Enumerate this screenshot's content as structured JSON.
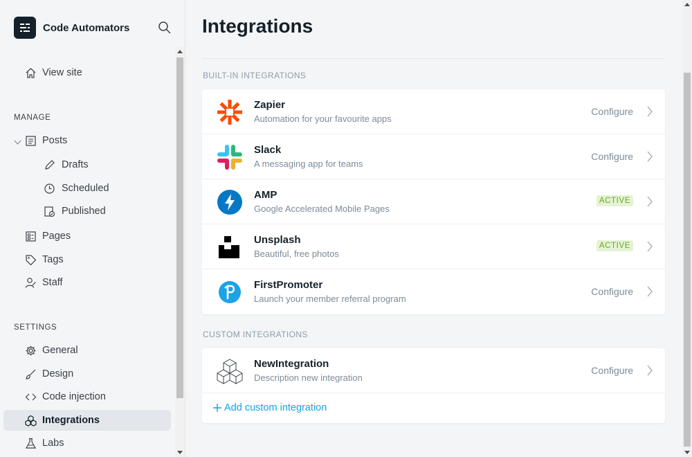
{
  "sidebar": {
    "brand": "Code Automators",
    "view_site": "View site",
    "manage_heading": "MANAGE",
    "posts": "Posts",
    "drafts": "Drafts",
    "scheduled": "Scheduled",
    "published": "Published",
    "pages": "Pages",
    "tags": "Tags",
    "staff": "Staff",
    "settings_heading": "SETTINGS",
    "general": "General",
    "design": "Design",
    "code_injection": "Code injection",
    "integrations": "Integrations",
    "labs": "Labs"
  },
  "main": {
    "title": "Integrations",
    "builtin_heading": "BUILT-IN INTEGRATIONS",
    "builtin": [
      {
        "name": "Zapier",
        "desc": "Automation for your favourite apps",
        "action": "Configure",
        "icon": "zapier-icon"
      },
      {
        "name": "Slack",
        "desc": "A messaging app for teams",
        "action": "Configure",
        "icon": "slack-icon"
      },
      {
        "name": "AMP",
        "desc": "Google Accelerated Mobile Pages",
        "status": "ACTIVE",
        "icon": "amp-icon"
      },
      {
        "name": "Unsplash",
        "desc": "Beautiful, free photos",
        "status": "ACTIVE",
        "icon": "unsplash-icon"
      },
      {
        "name": "FirstPromoter",
        "desc": "Launch your member referral program",
        "action": "Configure",
        "icon": "firstpromoter-icon"
      }
    ],
    "custom_heading": "CUSTOM INTEGRATIONS",
    "custom": [
      {
        "name": "NewIntegration",
        "desc": "Description new integration",
        "action": "Configure",
        "icon": "cubes-icon"
      }
    ],
    "add_custom": "Add custom integration"
  },
  "colors": {
    "accent": "#14a3e0",
    "active_badge_bg": "#e4f3d2",
    "active_badge_text": "#6aa82e",
    "zapier": "#ff4a00",
    "amp": "#0379c4",
    "firstpromoter": "#1ba3e6"
  }
}
